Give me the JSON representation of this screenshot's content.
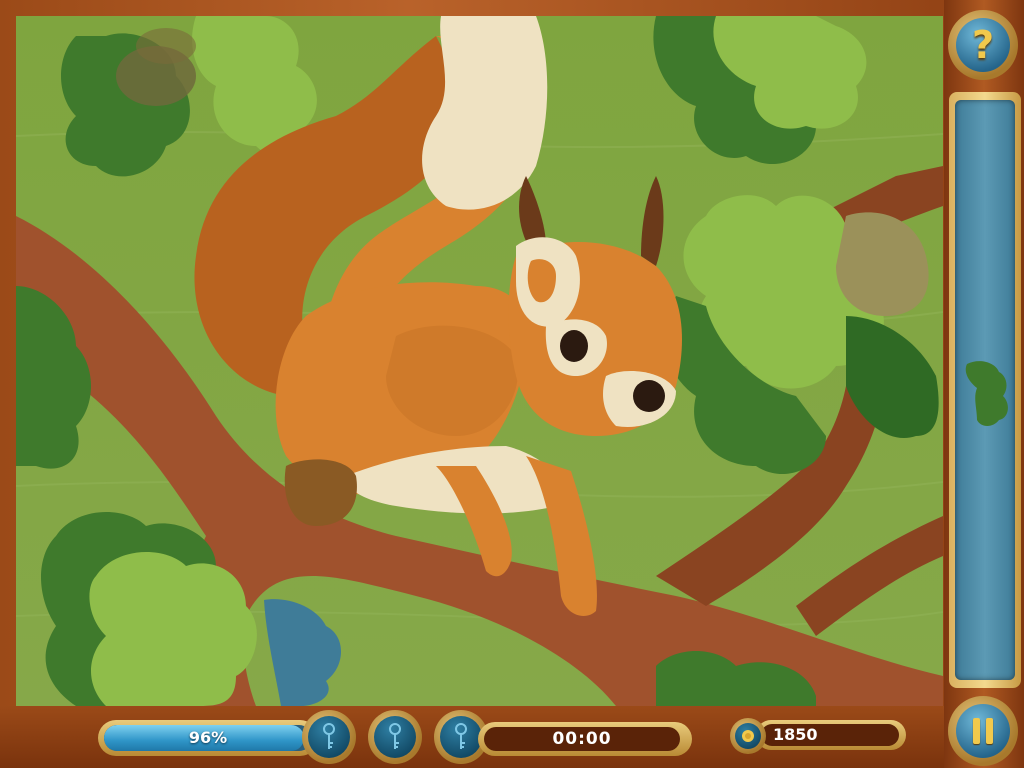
{
  "puzzle": {
    "subject": "squirrel-on-branch-wood-mosaic",
    "colors": {
      "background": "#7ea33c",
      "branch": "#a0522d",
      "squirrel": "#d9822f",
      "tail_tip": "#efe2c2",
      "leaf_light": "#8fbd4a",
      "leaf_dark": "#3f7a2c",
      "missing_piece": "#3f7c98"
    }
  },
  "sidebar": {
    "help_icon": "question-mark-icon",
    "pause_icon": "pause-icon",
    "tray_piece": "leaf-piece"
  },
  "hud": {
    "progress_label": "96%",
    "progress_value": 0.96,
    "hint_keys": [
      "key-icon",
      "key-icon",
      "key-icon"
    ],
    "timer": "00:00",
    "score": "1850",
    "coin_icon": "coin-icon"
  }
}
